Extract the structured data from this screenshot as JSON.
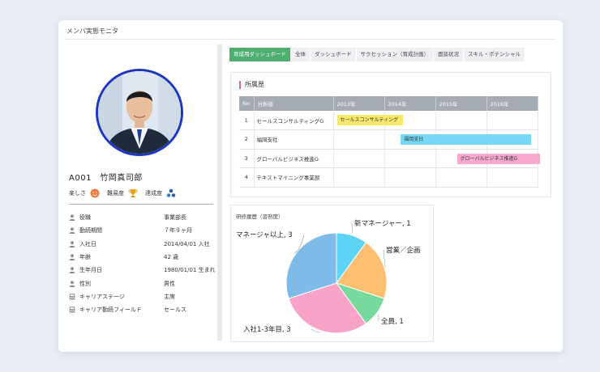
{
  "window": {
    "title": "メンバ実態モニタ"
  },
  "member": {
    "name": "A001　竹岡真司郎"
  },
  "emotions": [
    {
      "label": "楽しさ",
      "icon": "smiley-face-icon",
      "color": "#f07a3a"
    },
    {
      "label": "難易度",
      "icon": "trophy-icon",
      "color": "#e3a21a"
    },
    {
      "label": "達成度",
      "icon": "triangle-dots-icon",
      "color": "#2f5fb0"
    }
  ],
  "properties": [
    {
      "icon": "person-icon",
      "label": "役職",
      "value": "事業部長"
    },
    {
      "icon": "person-icon",
      "label": "勤続期間",
      "value": "７年９ヶ月"
    },
    {
      "icon": "person-icon",
      "label": "入社日",
      "value": "2014/04/01 入社"
    },
    {
      "icon": "person-icon",
      "label": "年齢",
      "value": "42 歳"
    },
    {
      "icon": "person-icon",
      "label": "生年月日",
      "value": "1980/01/01 生まれ"
    },
    {
      "icon": "person-icon",
      "label": "性別",
      "value": "男性"
    },
    {
      "icon": "calculator-icon",
      "label": "キャリアステージ",
      "value": "主席"
    },
    {
      "icon": "calculator-icon",
      "label": "キャリア勤続フィールド",
      "value": "セールス"
    }
  ],
  "tabs": [
    {
      "label": "育成用ダッシュボード",
      "active": true
    },
    {
      "label": "全体",
      "active": false
    },
    {
      "label": "ダッシュボード",
      "active": false
    },
    {
      "label": "サクセッション（育成計画）",
      "active": false
    },
    {
      "label": "面談状況",
      "active": false
    },
    {
      "label": "スキル・ポテンシャル",
      "active": false
    }
  ],
  "affiliation": {
    "title": "所属歴",
    "headers": [
      "No",
      "分析値",
      "2013年",
      "2014年",
      "2015年",
      "2016年"
    ],
    "rows": [
      {
        "no": "1",
        "name": "セールスコンサルティングG",
        "bar": {
          "label": "セールスコンサルティング",
          "color": "#f5e86a",
          "start": 2013.0,
          "end": 2014.3
        }
      },
      {
        "no": "2",
        "name": "福岡支社",
        "bar": {
          "label": "福岡支社",
          "color": "#76d8f5",
          "start": 2014.25,
          "end": 2016.8
        }
      },
      {
        "no": "3",
        "name": "グローバルビジネス推進G",
        "bar": {
          "label": "グローバルビジネス推進G",
          "color": "#f7a8cf",
          "start": 2015.35,
          "end": 2017.0
        }
      },
      {
        "no": "4",
        "name": "テキストマイニング事業部",
        "bar": null
      }
    ]
  },
  "pie": {
    "title": "研修履歴（習熟度）"
  },
  "chart_data": {
    "type": "pie",
    "title": "研修履歴（習熟度）",
    "slices": [
      {
        "name": "新マネージャー",
        "value": 1,
        "label": "新マネージャー, 1",
        "color": "#5ed4f5"
      },
      {
        "name": "営業／企画",
        "value": 2,
        "label": "営業／企画",
        "color": "#fdbf72"
      },
      {
        "name": "全員",
        "value": 1,
        "label": "全員, 1",
        "color": "#77d99b"
      },
      {
        "name": "入社1-3年目",
        "value": 3,
        "label": "入社1-3年目, 3",
        "color": "#f9a3c9"
      },
      {
        "name": "マネージャ以上",
        "value": 3,
        "label": "マネージャ以上, 3",
        "color": "#7fbbe9"
      }
    ]
  }
}
